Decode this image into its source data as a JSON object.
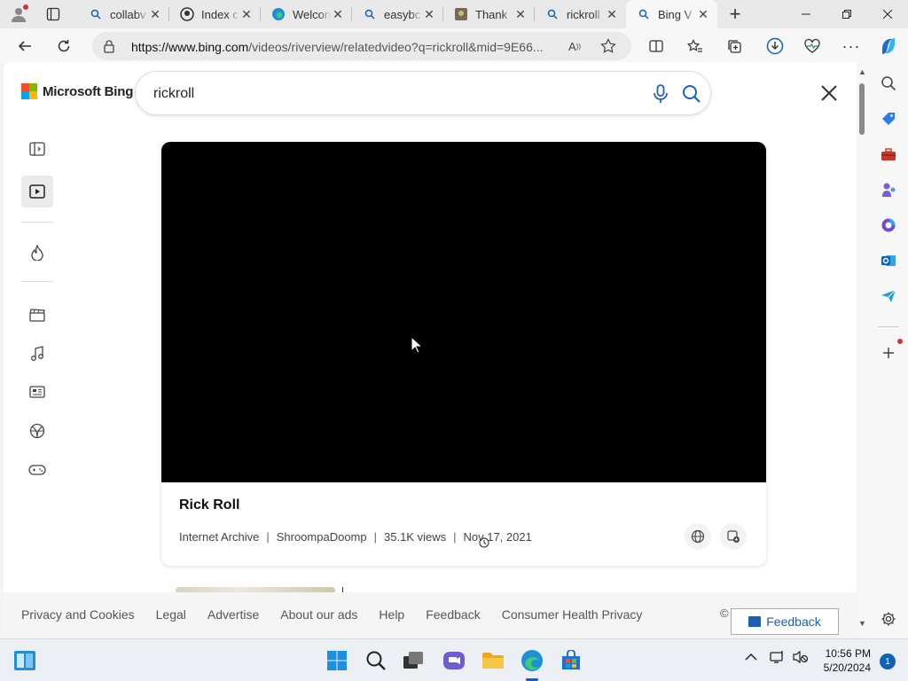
{
  "browser": {
    "tabs": [
      {
        "title": "collabv",
        "icon": "search-icon",
        "active": false
      },
      {
        "title": "Index c",
        "icon": "github-icon",
        "active": false
      },
      {
        "title": "Welcon",
        "icon": "edge-icon",
        "active": false
      },
      {
        "title": "easybc",
        "icon": "search-icon",
        "active": false
      },
      {
        "title": "Thank",
        "icon": "image-icon",
        "active": false
      },
      {
        "title": "rickroll",
        "icon": "search-icon",
        "active": false
      },
      {
        "title": "Bing V",
        "icon": "search-icon",
        "active": true
      }
    ],
    "url_host": "https://www.bing.com",
    "url_path": "/videos/riverview/relatedvideo?q=rickroll&mid=9E66..."
  },
  "bing": {
    "brand": "Microsoft Bing",
    "search_query": "rickroll"
  },
  "video": {
    "title": "Rick Roll",
    "source": "Internet Archive",
    "channel": "ShroompaDoomp",
    "views": "35.1K views",
    "date": "Nov 17, 2021"
  },
  "footer": {
    "links": [
      "Privacy and Cookies",
      "Legal",
      "Advertise",
      "About our ads",
      "Help",
      "Feedback",
      "Consumer Health Privacy"
    ],
    "copyright": "©",
    "feedback_button": "Feedback"
  },
  "taskbar": {
    "time": "10:56 PM",
    "date": "5/20/2024",
    "notification_count": "1"
  },
  "colors": {
    "bing_red": "#f25022",
    "bing_green": "#7fba00",
    "bing_blue": "#00a4ef",
    "bing_yellow": "#ffb900",
    "accent": "#0f62b7"
  }
}
